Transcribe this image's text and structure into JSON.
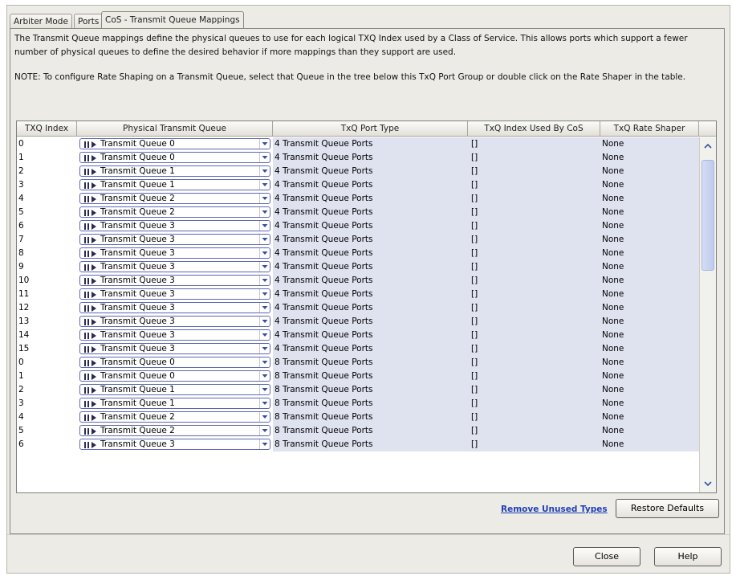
{
  "tabs": [
    {
      "label": "Arbiter Mode",
      "active": false
    },
    {
      "label": "Ports",
      "active": false
    },
    {
      "label": "CoS - Transmit Queue Mappings",
      "active": true
    }
  ],
  "description": {
    "para1": "The Transmit Queue mappings define the physical queues to use for each logical TXQ Index used by a Class of Service. This allows ports which support a fewer number of physical queues to define the desired behavior if more mappings than they support are used.",
    "para2": "NOTE: To configure Rate Shaping on a Transmit Queue, select that Queue in the tree below this TxQ Port Group or double click on the Rate Shaper in the table."
  },
  "table": {
    "columns": [
      "TXQ Index",
      "Physical Transmit Queue",
      "TxQ Port Type",
      "TxQ Index Used By CoS",
      "TxQ Rate Shaper"
    ],
    "rows": [
      [
        "0",
        "Transmit Queue 0",
        "4 Transmit Queue Ports",
        "[]",
        "None"
      ],
      [
        "1",
        "Transmit Queue 0",
        "4 Transmit Queue Ports",
        "[]",
        "None"
      ],
      [
        "2",
        "Transmit Queue 1",
        "4 Transmit Queue Ports",
        "[]",
        "None"
      ],
      [
        "3",
        "Transmit Queue 1",
        "4 Transmit Queue Ports",
        "[]",
        "None"
      ],
      [
        "4",
        "Transmit Queue 2",
        "4 Transmit Queue Ports",
        "[]",
        "None"
      ],
      [
        "5",
        "Transmit Queue 2",
        "4 Transmit Queue Ports",
        "[]",
        "None"
      ],
      [
        "6",
        "Transmit Queue 3",
        "4 Transmit Queue Ports",
        "[]",
        "None"
      ],
      [
        "7",
        "Transmit Queue 3",
        "4 Transmit Queue Ports",
        "[]",
        "None"
      ],
      [
        "8",
        "Transmit Queue 3",
        "4 Transmit Queue Ports",
        "[]",
        "None"
      ],
      [
        "9",
        "Transmit Queue 3",
        "4 Transmit Queue Ports",
        "[]",
        "None"
      ],
      [
        "10",
        "Transmit Queue 3",
        "4 Transmit Queue Ports",
        "[]",
        "None"
      ],
      [
        "11",
        "Transmit Queue 3",
        "4 Transmit Queue Ports",
        "[]",
        "None"
      ],
      [
        "12",
        "Transmit Queue 3",
        "4 Transmit Queue Ports",
        "[]",
        "None"
      ],
      [
        "13",
        "Transmit Queue 3",
        "4 Transmit Queue Ports",
        "[]",
        "None"
      ],
      [
        "14",
        "Transmit Queue 3",
        "4 Transmit Queue Ports",
        "[]",
        "None"
      ],
      [
        "15",
        "Transmit Queue 3",
        "4 Transmit Queue Ports",
        "[]",
        "None"
      ],
      [
        "0",
        "Transmit Queue 0",
        "8 Transmit Queue Ports",
        "[]",
        "None"
      ],
      [
        "1",
        "Transmit Queue 0",
        "8 Transmit Queue Ports",
        "[]",
        "None"
      ],
      [
        "2",
        "Transmit Queue 1",
        "8 Transmit Queue Ports",
        "[]",
        "None"
      ],
      [
        "3",
        "Transmit Queue 1",
        "8 Transmit Queue Ports",
        "[]",
        "None"
      ],
      [
        "4",
        "Transmit Queue 2",
        "8 Transmit Queue Ports",
        "[]",
        "None"
      ],
      [
        "5",
        "Transmit Queue 2",
        "8 Transmit Queue Ports",
        "[]",
        "None"
      ],
      [
        "6",
        "Transmit Queue 3",
        "8 Transmit Queue Ports",
        "[]",
        "None"
      ]
    ]
  },
  "icons": {
    "queue": "queue-icon",
    "dropdown": "chevron-down-icon",
    "scroll_up": "scroll-up-icon",
    "scroll_down": "scroll-down-icon"
  },
  "actions": {
    "remove_unused": "Remove Unused Types",
    "restore_defaults": "Restore Defaults"
  },
  "footer": {
    "close": "Close",
    "help": "Help"
  },
  "colors": {
    "readonly_cell_bg": "#dfe2ef",
    "link": "#1f3fb5",
    "combo_border": "#5d66b6"
  }
}
